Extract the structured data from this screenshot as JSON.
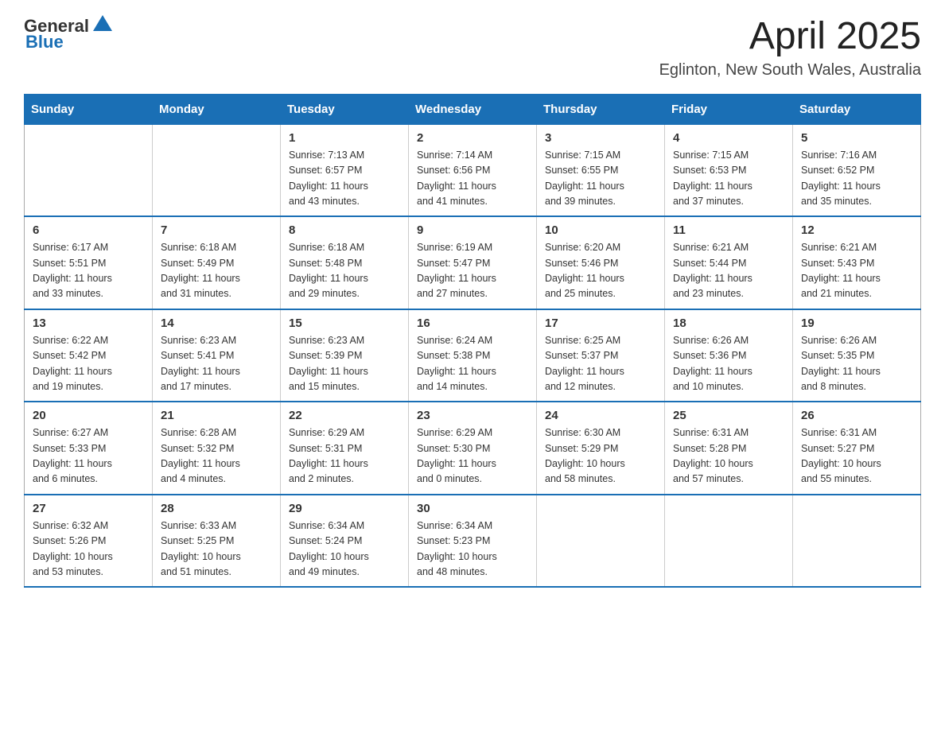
{
  "header": {
    "logo_general": "General",
    "logo_blue": "Blue",
    "month_year": "April 2025",
    "location": "Eglinton, New South Wales, Australia"
  },
  "days_of_week": [
    "Sunday",
    "Monday",
    "Tuesday",
    "Wednesday",
    "Thursday",
    "Friday",
    "Saturday"
  ],
  "weeks": [
    [
      {
        "day": "",
        "info": ""
      },
      {
        "day": "",
        "info": ""
      },
      {
        "day": "1",
        "info": "Sunrise: 7:13 AM\nSunset: 6:57 PM\nDaylight: 11 hours\nand 43 minutes."
      },
      {
        "day": "2",
        "info": "Sunrise: 7:14 AM\nSunset: 6:56 PM\nDaylight: 11 hours\nand 41 minutes."
      },
      {
        "day": "3",
        "info": "Sunrise: 7:15 AM\nSunset: 6:55 PM\nDaylight: 11 hours\nand 39 minutes."
      },
      {
        "day": "4",
        "info": "Sunrise: 7:15 AM\nSunset: 6:53 PM\nDaylight: 11 hours\nand 37 minutes."
      },
      {
        "day": "5",
        "info": "Sunrise: 7:16 AM\nSunset: 6:52 PM\nDaylight: 11 hours\nand 35 minutes."
      }
    ],
    [
      {
        "day": "6",
        "info": "Sunrise: 6:17 AM\nSunset: 5:51 PM\nDaylight: 11 hours\nand 33 minutes."
      },
      {
        "day": "7",
        "info": "Sunrise: 6:18 AM\nSunset: 5:49 PM\nDaylight: 11 hours\nand 31 minutes."
      },
      {
        "day": "8",
        "info": "Sunrise: 6:18 AM\nSunset: 5:48 PM\nDaylight: 11 hours\nand 29 minutes."
      },
      {
        "day": "9",
        "info": "Sunrise: 6:19 AM\nSunset: 5:47 PM\nDaylight: 11 hours\nand 27 minutes."
      },
      {
        "day": "10",
        "info": "Sunrise: 6:20 AM\nSunset: 5:46 PM\nDaylight: 11 hours\nand 25 minutes."
      },
      {
        "day": "11",
        "info": "Sunrise: 6:21 AM\nSunset: 5:44 PM\nDaylight: 11 hours\nand 23 minutes."
      },
      {
        "day": "12",
        "info": "Sunrise: 6:21 AM\nSunset: 5:43 PM\nDaylight: 11 hours\nand 21 minutes."
      }
    ],
    [
      {
        "day": "13",
        "info": "Sunrise: 6:22 AM\nSunset: 5:42 PM\nDaylight: 11 hours\nand 19 minutes."
      },
      {
        "day": "14",
        "info": "Sunrise: 6:23 AM\nSunset: 5:41 PM\nDaylight: 11 hours\nand 17 minutes."
      },
      {
        "day": "15",
        "info": "Sunrise: 6:23 AM\nSunset: 5:39 PM\nDaylight: 11 hours\nand 15 minutes."
      },
      {
        "day": "16",
        "info": "Sunrise: 6:24 AM\nSunset: 5:38 PM\nDaylight: 11 hours\nand 14 minutes."
      },
      {
        "day": "17",
        "info": "Sunrise: 6:25 AM\nSunset: 5:37 PM\nDaylight: 11 hours\nand 12 minutes."
      },
      {
        "day": "18",
        "info": "Sunrise: 6:26 AM\nSunset: 5:36 PM\nDaylight: 11 hours\nand 10 minutes."
      },
      {
        "day": "19",
        "info": "Sunrise: 6:26 AM\nSunset: 5:35 PM\nDaylight: 11 hours\nand 8 minutes."
      }
    ],
    [
      {
        "day": "20",
        "info": "Sunrise: 6:27 AM\nSunset: 5:33 PM\nDaylight: 11 hours\nand 6 minutes."
      },
      {
        "day": "21",
        "info": "Sunrise: 6:28 AM\nSunset: 5:32 PM\nDaylight: 11 hours\nand 4 minutes."
      },
      {
        "day": "22",
        "info": "Sunrise: 6:29 AM\nSunset: 5:31 PM\nDaylight: 11 hours\nand 2 minutes."
      },
      {
        "day": "23",
        "info": "Sunrise: 6:29 AM\nSunset: 5:30 PM\nDaylight: 11 hours\nand 0 minutes."
      },
      {
        "day": "24",
        "info": "Sunrise: 6:30 AM\nSunset: 5:29 PM\nDaylight: 10 hours\nand 58 minutes."
      },
      {
        "day": "25",
        "info": "Sunrise: 6:31 AM\nSunset: 5:28 PM\nDaylight: 10 hours\nand 57 minutes."
      },
      {
        "day": "26",
        "info": "Sunrise: 6:31 AM\nSunset: 5:27 PM\nDaylight: 10 hours\nand 55 minutes."
      }
    ],
    [
      {
        "day": "27",
        "info": "Sunrise: 6:32 AM\nSunset: 5:26 PM\nDaylight: 10 hours\nand 53 minutes."
      },
      {
        "day": "28",
        "info": "Sunrise: 6:33 AM\nSunset: 5:25 PM\nDaylight: 10 hours\nand 51 minutes."
      },
      {
        "day": "29",
        "info": "Sunrise: 6:34 AM\nSunset: 5:24 PM\nDaylight: 10 hours\nand 49 minutes."
      },
      {
        "day": "30",
        "info": "Sunrise: 6:34 AM\nSunset: 5:23 PM\nDaylight: 10 hours\nand 48 minutes."
      },
      {
        "day": "",
        "info": ""
      },
      {
        "day": "",
        "info": ""
      },
      {
        "day": "",
        "info": ""
      }
    ]
  ]
}
